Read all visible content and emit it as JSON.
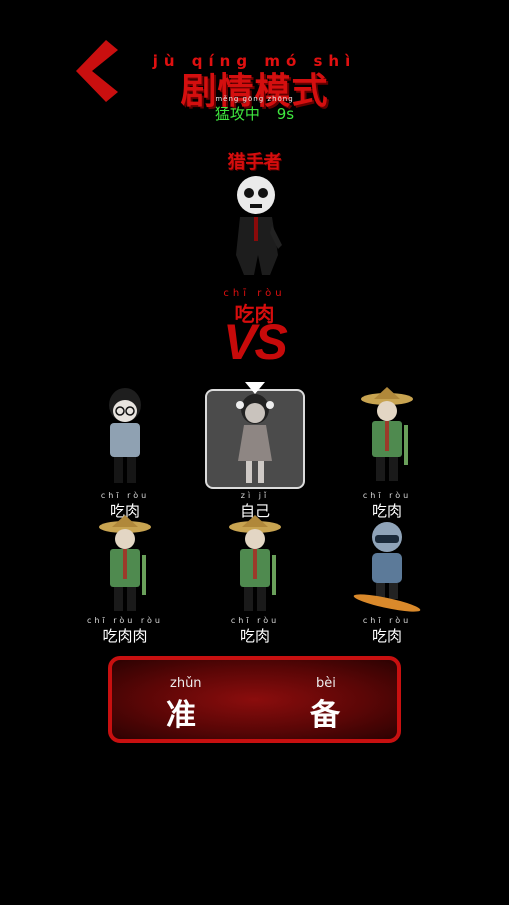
{
  "header": {
    "title_pinyin": "jù qíng mó shì",
    "title": "剧情模式",
    "status_pinyin": "měng gōng zhōng",
    "status_label": "猛攻中",
    "timer": "9s"
  },
  "hunter": {
    "role_label": "猎手者",
    "name_pinyin": "chī ròu",
    "name": "吃肉",
    "vs": "VS"
  },
  "players": [
    {
      "pinyin": "chī ròu",
      "name": "吃肉",
      "selected": false
    },
    {
      "pinyin": "zì jǐ",
      "name": "自己",
      "selected": true
    },
    {
      "pinyin": "chī ròu",
      "name": "吃肉",
      "selected": false
    },
    {
      "pinyin": "chī ròu ròu",
      "name": "吃肉肉",
      "selected": false
    },
    {
      "pinyin": "chī ròu",
      "name": "吃肉",
      "selected": false
    },
    {
      "pinyin": "chī ròu",
      "name": "吃肉",
      "selected": false
    }
  ],
  "ready_button": {
    "left_pinyin": "zhǔn",
    "left_char": "准",
    "right_pinyin": "bèi",
    "right_char": "备"
  },
  "colors": {
    "accent_red": "#d40f0f",
    "status_green": "#3fe83f"
  }
}
